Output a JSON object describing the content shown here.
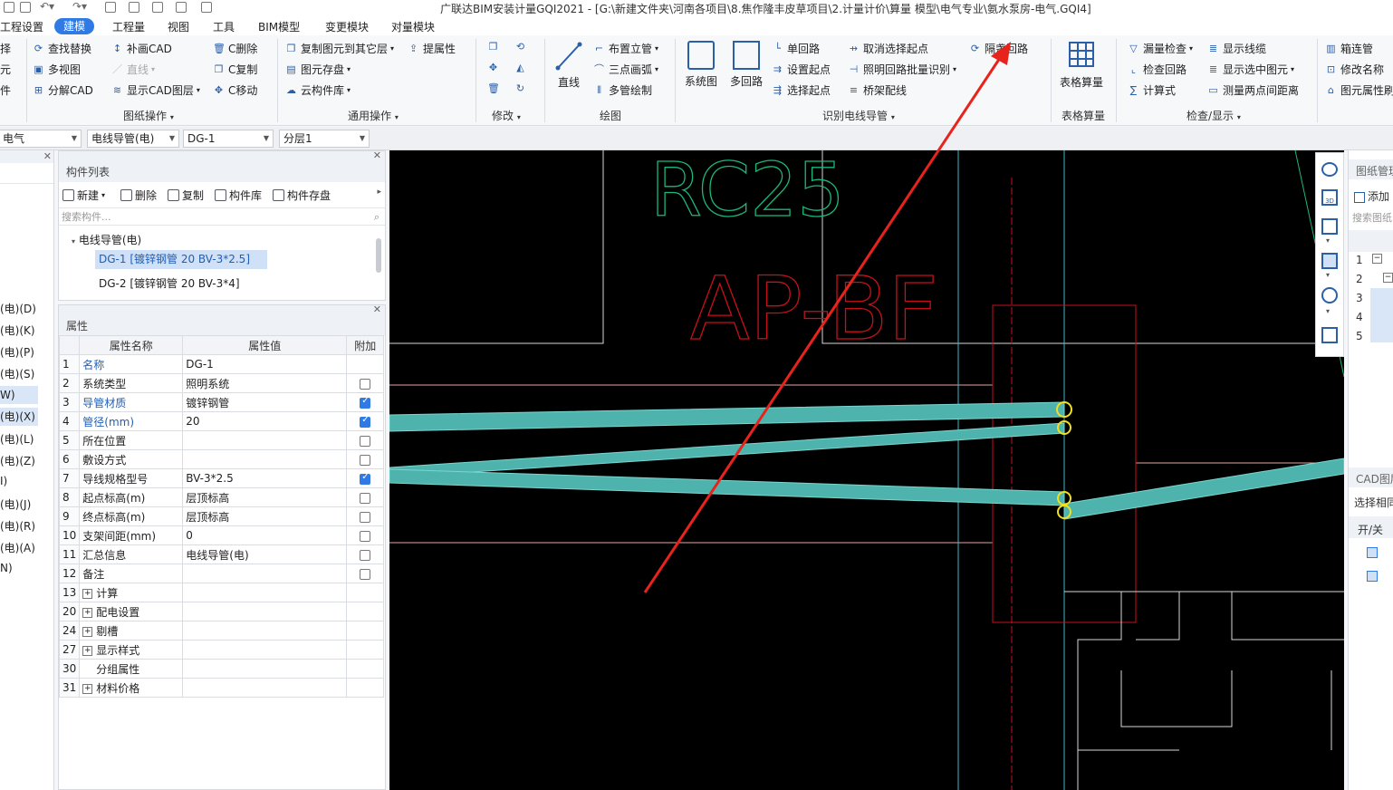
{
  "window": {
    "title": "广联达BIM安装计量GQI2021 - [G:\\新建文件夹\\河南各项目\\8.焦作隆丰皮草项目\\2.计量计价\\算量 模型\\电气专业\\氨水泵房-电气.GQI4]"
  },
  "menu": [
    "工程设置",
    "建模",
    "工程量",
    "视图",
    "工具",
    "BIM模型",
    "变更模块",
    "对量模块"
  ],
  "ribbon": {
    "left_partial": [
      "择",
      "元",
      "件"
    ],
    "drawing_ops": {
      "find_replace": "查找替换",
      "supplement_cad": "补画CAD",
      "c_delete": "C删除",
      "multi_view": "多视图",
      "line": "直线",
      "c_copy": "C复制",
      "decompose_cad": "分解CAD",
      "show_cad_layer": "显示CAD图层",
      "c_move": "C移动",
      "label": "图纸操作"
    },
    "general_ops": {
      "copy_to_floor": "复制图元到其它层",
      "extract_attr": "提属性",
      "element_store": "图元存盘",
      "cloud_library": "云构件库",
      "label": "通用操作"
    },
    "modify": {
      "label": "修改"
    },
    "draw": {
      "straight": "直线",
      "vertical_pipe": "布置立管",
      "three_point_arc": "三点画弧",
      "multi_pipe": "多管绘制",
      "label": "绘图"
    },
    "identify": {
      "system_diagram": "系统图",
      "multi_loop": "多回路",
      "single_loop": "单回路",
      "set_start": "设置起点",
      "select_start": "选择起点",
      "cancel_start": "取消选择起点",
      "lighting_batch": "照明回路批量识别",
      "tray_wiring": "桥架配线",
      "cross_floor": "隔盏回路",
      "label": "识别电线导管"
    },
    "table_calc": {
      "big": "表格算量",
      "label": "表格算量"
    },
    "check": {
      "leak_check": "漏量检查",
      "check_loop": "检查回路",
      "formula": "计算式",
      "show_line": "显示线缆",
      "show_selected": "显示选中图元",
      "measure": "测量两点间距离",
      "label": "检查/显示"
    },
    "right_partial": {
      "box_connect": "箱连管",
      "rename": "修改名称",
      "element_attr": "图元属性刷"
    }
  },
  "selectors": [
    "电气",
    "电线导管(电)",
    "DG-1",
    "分层1"
  ],
  "left_nav": [
    "(电)(D)",
    "(电)(K)",
    "(电)(P)",
    "(电)(S)",
    "W)",
    "(电)(X)",
    "(电)(L)",
    "(电)(Z)",
    "I)",
    "(电)(J)",
    "(电)(R)",
    "(电)(A)",
    "N)"
  ],
  "component_list": {
    "title": "构件列表",
    "tools": [
      "新建",
      "删除",
      "复制",
      "构件库",
      "构件存盘"
    ],
    "search_placeholder": "搜索构件...",
    "tree_root": "电线导管(电)",
    "items": [
      "DG-1 [镀锌钢管 20 BV-3*2.5]",
      "DG-2 [镀锌钢管 20 BV-3*4]"
    ]
  },
  "properties": {
    "title": "属性",
    "headers": [
      "属性名称",
      "属性值",
      "附加"
    ],
    "rows": [
      {
        "num": "1",
        "name": "名称",
        "value": "DG-1",
        "blue": true,
        "check": "none"
      },
      {
        "num": "2",
        "name": "系统类型",
        "value": "照明系统",
        "blue": false,
        "check": "off"
      },
      {
        "num": "3",
        "name": "导管材质",
        "value": "镀锌钢管",
        "blue": true,
        "check": "on"
      },
      {
        "num": "4",
        "name": "管径(mm)",
        "value": "20",
        "blue": true,
        "check": "on"
      },
      {
        "num": "5",
        "name": "所在位置",
        "value": "",
        "blue": false,
        "check": "off"
      },
      {
        "num": "6",
        "name": "敷设方式",
        "value": "",
        "blue": false,
        "check": "off"
      },
      {
        "num": "7",
        "name": "导线规格型号",
        "value": "BV-3*2.5",
        "blue": false,
        "check": "on"
      },
      {
        "num": "8",
        "name": "起点标高(m)",
        "value": "层顶标高",
        "blue": false,
        "check": "off"
      },
      {
        "num": "9",
        "name": "终点标高(m)",
        "value": "层顶标高",
        "blue": false,
        "check": "off"
      },
      {
        "num": "10",
        "name": "支架间距(mm)",
        "value": "0",
        "blue": false,
        "check": "off"
      },
      {
        "num": "11",
        "name": "汇总信息",
        "value": "电线导管(电)",
        "blue": false,
        "check": "off"
      },
      {
        "num": "12",
        "name": "备注",
        "value": "",
        "blue": false,
        "check": "off"
      },
      {
        "num": "13",
        "name": "计算",
        "value": "",
        "blue": false,
        "check": "none",
        "expand": true
      },
      {
        "num": "20",
        "name": "配电设置",
        "value": "",
        "blue": false,
        "check": "none",
        "expand": true
      },
      {
        "num": "24",
        "name": "剔槽",
        "value": "",
        "blue": false,
        "check": "none",
        "expand": true
      },
      {
        "num": "27",
        "name": "显示样式",
        "value": "",
        "blue": false,
        "check": "none",
        "expand": true
      },
      {
        "num": "30",
        "name": "分组属性",
        "value": "",
        "blue": false,
        "check": "none",
        "expand": false
      },
      {
        "num": "31",
        "name": "材料价格",
        "value": "",
        "blue": false,
        "check": "none",
        "expand": true
      }
    ]
  },
  "canvas": {
    "text_green": "RC25",
    "text_red": "AP-BF"
  },
  "right_panel": {
    "drawing_mgr": "图纸管理",
    "add": "添加",
    "search": "搜索图纸",
    "rows": [
      "1",
      "2",
      "3",
      "4",
      "5"
    ],
    "cad_layer": "CAD图层",
    "select_same": "选择相同",
    "onoff": "开/关"
  },
  "colors": {
    "accent": "#2f7ae5",
    "pipe": "#4fb3ad",
    "annotation_arrow": "#e8231b",
    "cad_green": "#1bb87a",
    "cad_red": "#c8101a"
  }
}
